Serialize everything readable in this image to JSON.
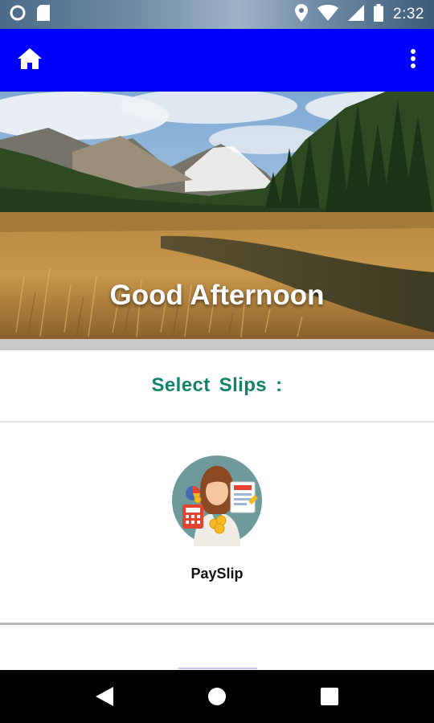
{
  "status_bar": {
    "time": "2:32",
    "icons": [
      "record-circle-icon",
      "sd-card-icon",
      "location-pin-icon",
      "wifi-icon",
      "cell-signal-icon",
      "battery-icon"
    ]
  },
  "app_bar": {
    "color": "#0000FF",
    "left_icon": "home-icon",
    "right_icon": "more-vertical-icon"
  },
  "banner": {
    "greeting": "Good Afternoon",
    "image": "mountain-meadow-landscape"
  },
  "section": {
    "title": "Select  Slips :",
    "title_color": "#13826B"
  },
  "slips": [
    {
      "label": "PaySlip",
      "icon": "payslip-avatar-icon"
    }
  ],
  "nav_bar": {
    "buttons": [
      "back-icon",
      "home-circle-icon",
      "recents-square-icon"
    ]
  }
}
